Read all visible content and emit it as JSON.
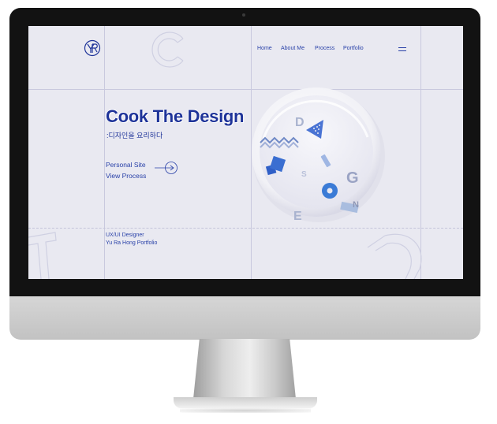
{
  "site": {
    "logo_text": "YR",
    "nav": [
      "Home",
      "About Me",
      "Process",
      "Portfolio"
    ],
    "hero_title": "Cook The Design",
    "hero_subtitle": ":디자인을 요리하다",
    "links": [
      "Personal Site",
      "View Process"
    ],
    "role": "UX/UI Designer",
    "owner": "Yu Ra Hong Portfolio",
    "bowl_letters": [
      "D",
      "G",
      "E",
      "N",
      "S"
    ]
  },
  "colors": {
    "accent": "#1e3399",
    "screen_bg": "#e9e9f1",
    "bowl_blue": "#3a6ed1"
  },
  "icons": {
    "menu": "hamburger-menu-icon",
    "arrow": "arrow-right-icon",
    "logo": "yr-logo-icon"
  }
}
